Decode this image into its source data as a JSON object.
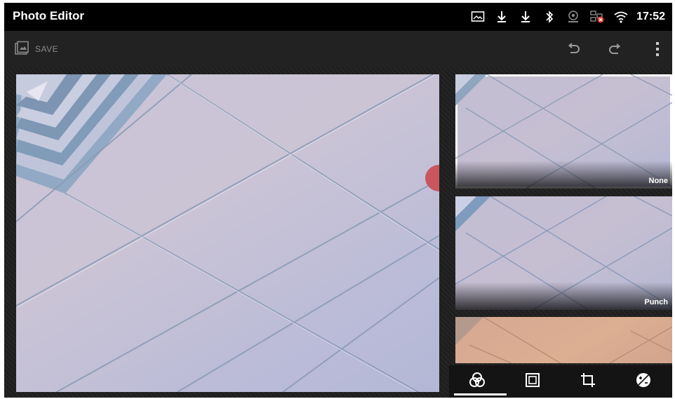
{
  "app": {
    "title": "Photo Editor"
  },
  "status_bar": {
    "time": "17:52",
    "icons": [
      "image-icon",
      "download-icon",
      "download-icon",
      "bluetooth-icon",
      "camera-icon",
      "network-error-icon",
      "wifi-icon"
    ]
  },
  "action_bar": {
    "save_label": "SAVE",
    "icons": [
      "save-image-icon",
      "undo-icon",
      "redo-icon",
      "overflow-menu-icon"
    ]
  },
  "filters": [
    {
      "label": "None",
      "selected": true
    },
    {
      "label": "Punch",
      "selected": false
    },
    {
      "label": "",
      "selected": false
    }
  ],
  "tabs": [
    {
      "icon": "filters-tab-icon",
      "active": true
    },
    {
      "icon": "borders-tab-icon",
      "active": false
    },
    {
      "icon": "crop-tab-icon",
      "active": false
    },
    {
      "icon": "adjust-tab-icon",
      "active": false
    }
  ],
  "colors": {
    "status_bar": "#000000",
    "action_bar": "#222222",
    "accent": "#ffffff"
  }
}
